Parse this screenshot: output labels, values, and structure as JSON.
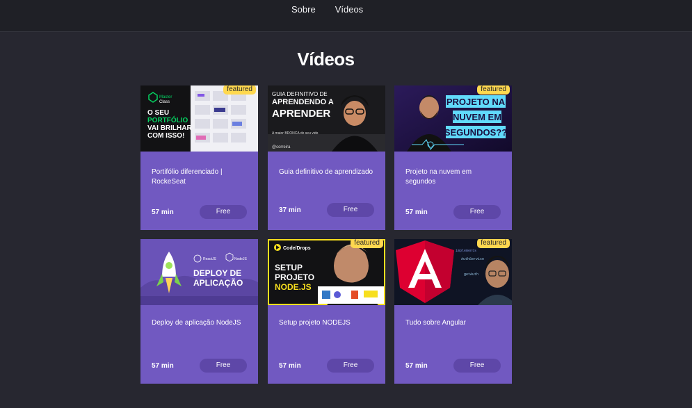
{
  "nav": {
    "items": [
      {
        "label": "Sobre"
      },
      {
        "label": "Vídeos"
      }
    ]
  },
  "page": {
    "title": "Vídeos"
  },
  "videos": [
    {
      "title": "Portifólio diferenciado | RockeSeat",
      "duration": "57 min",
      "price": "Free",
      "featured": true,
      "badge": "featured",
      "thumb_text": {
        "line1": "Master",
        "line2": "Class",
        "l3": "O SEU",
        "l4": "PORTFÓLIO",
        "l5": "VAI BRILHAR",
        "l6": "COM ISSO!"
      }
    },
    {
      "title": "Guia definitivo de aprendizado",
      "duration": "37 min",
      "price": "Free",
      "featured": false,
      "thumb_text": {
        "l1": "GUIA DEFINITIVO DE",
        "l2": "APRENDENDO A",
        "l3": "APRENDER",
        "l4": "A maior BRONCA do seu vido",
        "l5": "@correira"
      }
    },
    {
      "title": "Projeto na nuvem em segundos",
      "duration": "57 min",
      "price": "Free",
      "featured": true,
      "badge": "featured",
      "thumb_text": {
        "l1": "PROJETO NA",
        "l2": "NUVEM EM",
        "l3": "SEGUNDOS??"
      }
    },
    {
      "title": "Deploy de aplicação NodeJS",
      "duration": "57 min",
      "price": "Free",
      "featured": false,
      "thumb_text": {
        "l1": "ReactJS",
        "l2": "NodeJS",
        "l3": "DEPLOY DE",
        "l4": "APLICAÇÃO"
      }
    },
    {
      "title": "Setup projeto NODEJS",
      "duration": "57 min",
      "price": "Free",
      "featured": true,
      "badge": "featured",
      "thumb_text": {
        "l1": "Code/Drops",
        "l2": "SETUP",
        "l3": "PROJETO",
        "l4": "NODE.JS"
      }
    },
    {
      "title": "Tudo sobre Angular",
      "duration": "57 min",
      "price": "Free",
      "featured": true,
      "badge": "featured",
      "thumb_text": {
        "l1": "implements",
        "l2": "AuthService",
        "l3": "getAuth"
      }
    }
  ],
  "colors": {
    "background": "#272730",
    "topbar": "#1f2026",
    "card": "#7159c1",
    "button": "#5e47a8",
    "badge": "#ffd84f"
  }
}
